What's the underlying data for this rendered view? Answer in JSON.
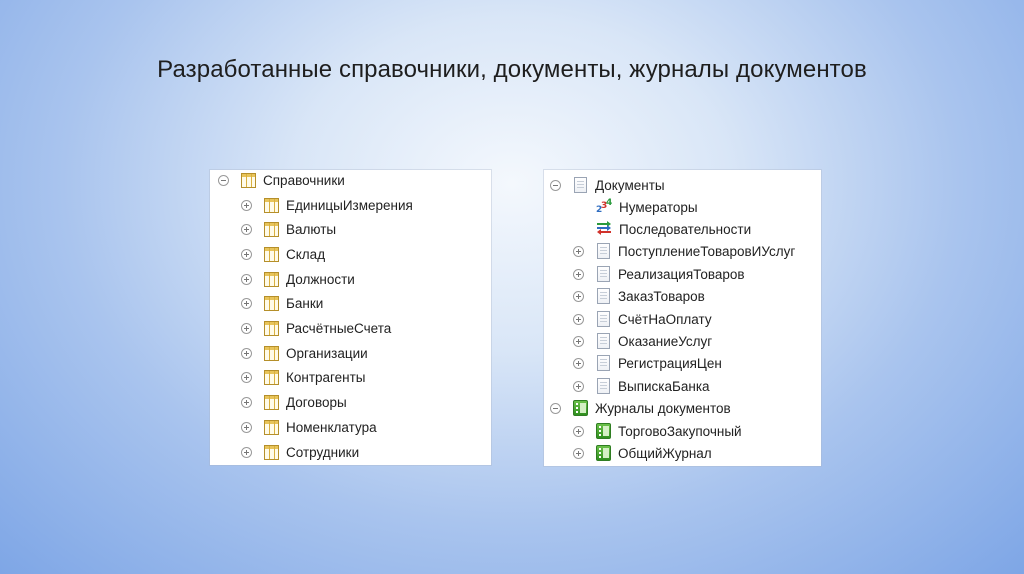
{
  "slide": {
    "title": "Разработанные справочники, документы, журналы документов"
  },
  "left_panel": {
    "root": {
      "label": "Справочники",
      "icon": "catalog-icon",
      "expander": "collapse"
    },
    "items": [
      {
        "label": "ЕдиницыИзмерения",
        "icon": "catalog-icon"
      },
      {
        "label": "Валюты",
        "icon": "catalog-icon"
      },
      {
        "label": "Склад",
        "icon": "catalog-icon"
      },
      {
        "label": "Должности",
        "icon": "catalog-icon"
      },
      {
        "label": "Банки",
        "icon": "catalog-icon"
      },
      {
        "label": "РасчётныеСчета",
        "icon": "catalog-icon"
      },
      {
        "label": "Организации",
        "icon": "catalog-icon"
      },
      {
        "label": "Контрагенты",
        "icon": "catalog-icon"
      },
      {
        "label": "Договоры",
        "icon": "catalog-icon"
      },
      {
        "label": "Номенклатура",
        "icon": "catalog-icon"
      },
      {
        "label": "Сотрудники",
        "icon": "catalog-icon"
      }
    ]
  },
  "right_panel": {
    "documents_root": {
      "label": "Документы",
      "icon": "document-icon",
      "expander": "collapse"
    },
    "numerators": {
      "label": "Нумераторы",
      "icon": "numerators-icon"
    },
    "sequences": {
      "label": "Последовательности",
      "icon": "sequences-icon"
    },
    "documents": [
      {
        "label": "ПоступлениеТоваровИУслуг",
        "icon": "document-icon"
      },
      {
        "label": "РеализацияТоваров",
        "icon": "document-icon"
      },
      {
        "label": "ЗаказТоваров",
        "icon": "document-icon"
      },
      {
        "label": "СчётНаОплату",
        "icon": "document-icon"
      },
      {
        "label": "ОказаниеУслуг",
        "icon": "document-icon"
      },
      {
        "label": "РегистрацияЦен",
        "icon": "document-icon"
      },
      {
        "label": "ВыпискаБанка",
        "icon": "document-icon"
      }
    ],
    "journals_root": {
      "label": "Журналы документов",
      "icon": "journal-icon",
      "expander": "collapse"
    },
    "journals": [
      {
        "label": "ТорговоЗакупочный",
        "icon": "journal-icon"
      },
      {
        "label": "ОбщийЖурнал",
        "icon": "journal-icon"
      }
    ]
  },
  "numerator_glyphs": {
    "a": "2",
    "b": "3",
    "c": "4"
  }
}
